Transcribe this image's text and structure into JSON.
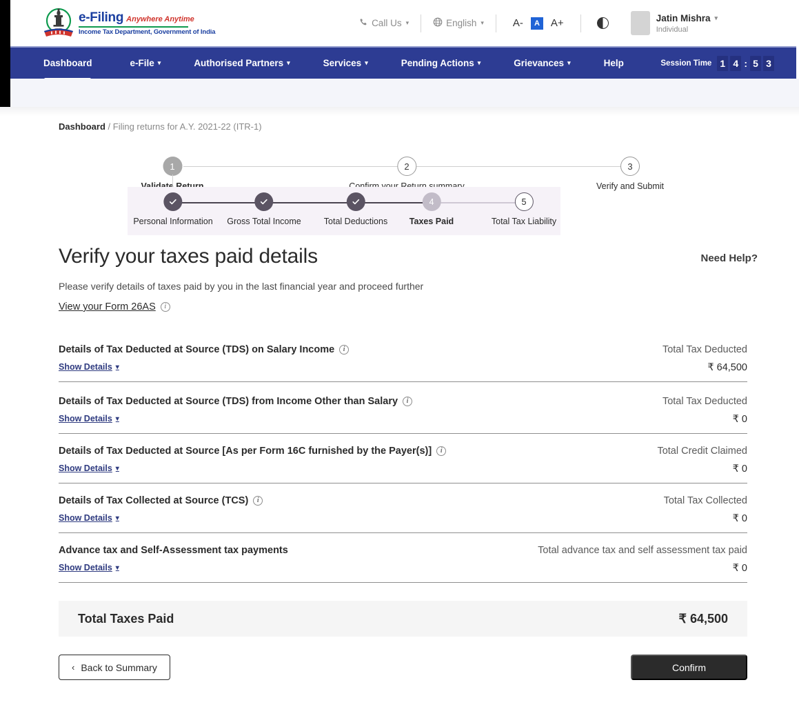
{
  "brand": {
    "emblem_icon": "india-national-emblem-icon",
    "name": "e-Filing",
    "tagline": "Anywhere Anytime",
    "department": "Income Tax Department, Government of India"
  },
  "header": {
    "call_us": {
      "label": "Call Us",
      "icon": "phone-icon"
    },
    "language": {
      "label": "English",
      "icon": "globe-icon"
    },
    "font_smaller": "A-",
    "font_normal": "A",
    "font_larger": "A+",
    "contrast_icon": "contrast-icon",
    "user": {
      "name": "Jatin Mishra",
      "role": "Individual",
      "avatar_icon": "avatar-icon"
    }
  },
  "nav": {
    "items": [
      {
        "label": "Dashboard",
        "has_caret": false,
        "active": true
      },
      {
        "label": "e-File",
        "has_caret": true,
        "active": false
      },
      {
        "label": "Authorised Partners",
        "has_caret": true,
        "active": false
      },
      {
        "label": "Services",
        "has_caret": true,
        "active": false
      },
      {
        "label": "Pending Actions",
        "has_caret": true,
        "active": false
      },
      {
        "label": "Grievances",
        "has_caret": true,
        "active": false
      },
      {
        "label": "Help",
        "has_caret": false,
        "active": false
      }
    ],
    "session": {
      "label": "Session Time",
      "digits": [
        "1",
        "4",
        "5",
        "3"
      ],
      "separator": ":"
    }
  },
  "breadcrumb": {
    "root": "Dashboard",
    "separator": " / ",
    "current": "Filing returns for A.Y. 2021-22 (ITR-1)"
  },
  "stepper_main": {
    "steps": [
      {
        "number": "1",
        "label": "Validate Return",
        "state": "current"
      },
      {
        "number": "2",
        "label": "Confirm your Return summary",
        "state": "idle"
      },
      {
        "number": "3",
        "label": "Verify and Submit",
        "state": "idle"
      }
    ]
  },
  "stepper_sub": {
    "steps": [
      {
        "number": "1",
        "label": "Personal Information",
        "state": "done"
      },
      {
        "number": "2",
        "label": "Gross Total Income",
        "state": "done"
      },
      {
        "number": "3",
        "label": "Total Deductions",
        "state": "done"
      },
      {
        "number": "4",
        "label": "Taxes Paid",
        "state": "current"
      },
      {
        "number": "5",
        "label": "Total Tax Liability",
        "state": "idle"
      }
    ]
  },
  "main": {
    "need_help": "Need Help?",
    "title": "Verify your taxes paid details",
    "subtitle": "Please verify details of taxes paid by you in the last financial year and proceed further",
    "form26as_link": "View your Form 26AS",
    "show_details_label": "Show Details",
    "rows": [
      {
        "title": "Details of Tax Deducted at Source (TDS) on Salary Income",
        "has_info": true,
        "caption": "Total Tax Deducted",
        "value": "₹ 64,500"
      },
      {
        "title": "Details of Tax Deducted at Source (TDS) from Income Other than Salary",
        "has_info": true,
        "caption": "Total Tax Deducted",
        "value": "₹ 0"
      },
      {
        "title": "Details of Tax Deducted at Source [As per Form 16C furnished by the Payer(s)]",
        "has_info": true,
        "caption": "Total Credit Claimed",
        "value": "₹ 0"
      },
      {
        "title": "Details of Tax Collected at Source (TCS)",
        "has_info": true,
        "caption": "Total Tax Collected",
        "value": "₹ 0"
      },
      {
        "title": "Advance tax and Self-Assessment tax payments",
        "has_info": false,
        "caption": "Total advance tax and self assessment tax paid",
        "value": "₹ 0"
      }
    ],
    "total": {
      "label": "Total Taxes Paid",
      "value": "₹ 64,500"
    }
  },
  "footer": {
    "back_label": "Back to Summary",
    "back_icon": "chevron-left-icon",
    "confirm_label": "Confirm"
  },
  "colors": {
    "nav_blue": "#2d3c93",
    "brand_blue": "#1a3fa0",
    "brand_red": "#d0342c",
    "brand_green": "#0e9a4e",
    "link_blue": "#2f3b80",
    "band_lavender": "#f6f2f8",
    "confirm_dark": "#2b2b2b"
  }
}
